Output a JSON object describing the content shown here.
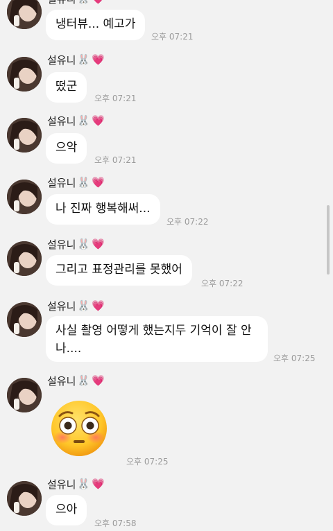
{
  "sender_name": "설유니",
  "sender_emojis": [
    "🐰",
    "💗"
  ],
  "icons": {
    "avatar": "profile-photo",
    "bunny": "rabbit-face-icon",
    "heart": "pink-heart-icon",
    "big_emoji": "flushed-face-emoji"
  },
  "colors": {
    "background": "#f2f2f2",
    "bubble": "#ffffff",
    "heart": "#ff3ea5",
    "time": "#9b9b9b"
  },
  "messages": [
    {
      "text": "냉터뷰... 예고가",
      "time": "오후 07:21"
    },
    {
      "text": "떴군",
      "time": "오후 07:21"
    },
    {
      "text": "으악",
      "time": "오후 07:21"
    },
    {
      "text": "나 진짜 행복해써...",
      "time": "오후 07:22"
    },
    {
      "text": "그리고 표정관리를 못했어",
      "time": "오후 07:22"
    },
    {
      "text": "사실 촬영 어떻게 했는지두 기억이 잘 안 나....",
      "time": "오후 07:25"
    },
    {
      "emoji": "😳",
      "time": "오후 07:25"
    },
    {
      "text": "으아",
      "time": "오후 07:58"
    }
  ]
}
